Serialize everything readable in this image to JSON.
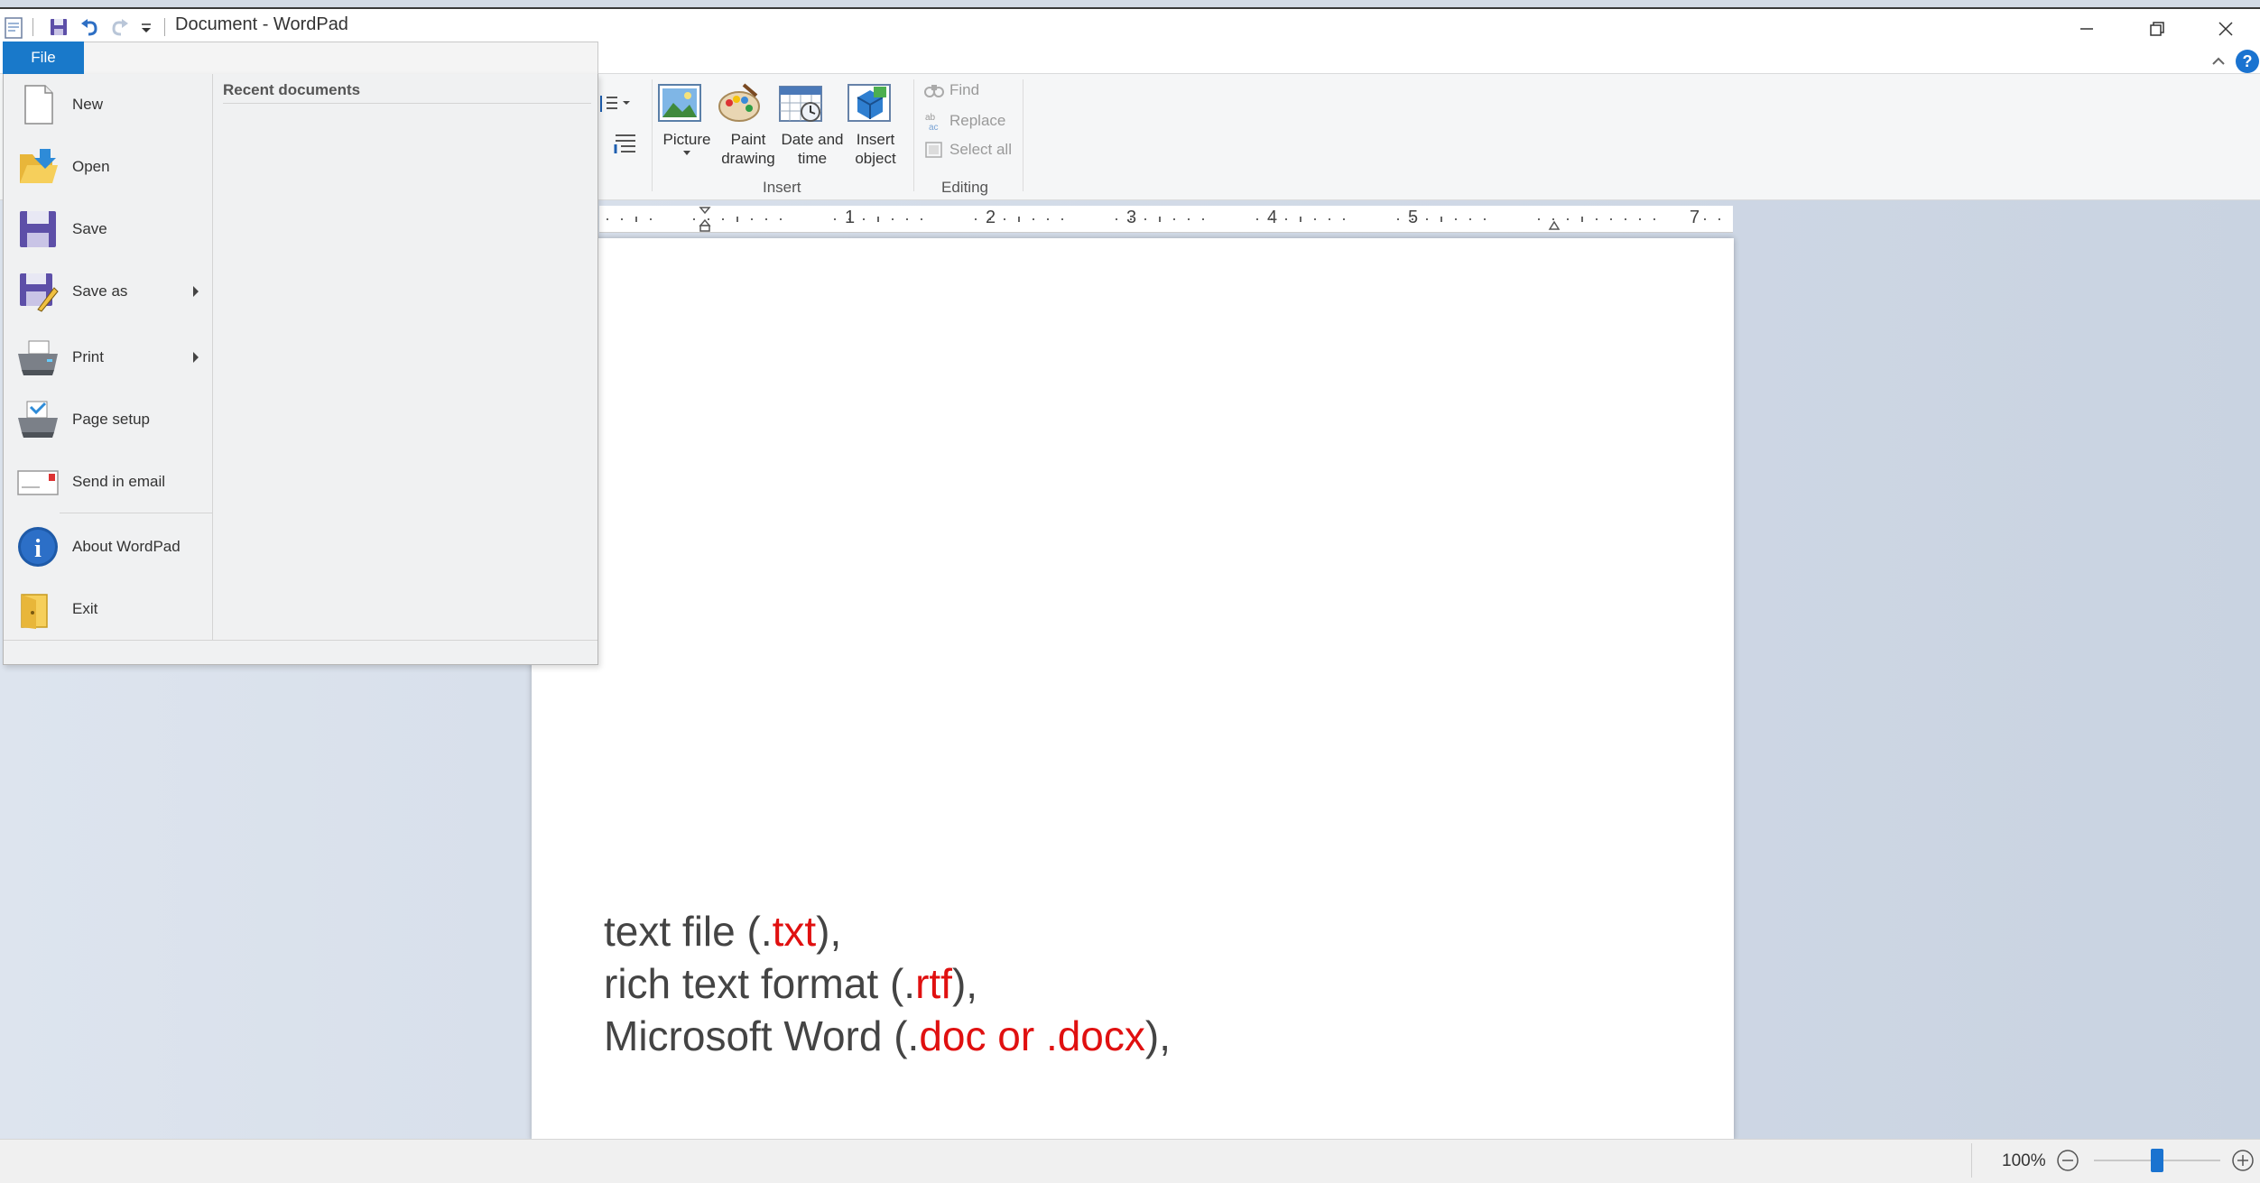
{
  "window": {
    "title": "Document - WordPad",
    "icons": {
      "app": "wordpad-icon",
      "save": "save-icon",
      "undo": "undo-icon",
      "redo": "redo-icon",
      "customize": "dropdown-icon",
      "minimize": "minimize-icon",
      "restore": "restore-icon",
      "close": "close-icon",
      "help": "help-icon",
      "collapse": "chevron-up-icon"
    }
  },
  "ribbon": {
    "insert_group": {
      "label": "Insert",
      "buttons": [
        {
          "line1": "Picture",
          "line2": "",
          "icon": "picture-icon"
        },
        {
          "line1": "Paint",
          "line2": "drawing",
          "icon": "paint-icon"
        },
        {
          "line1": "Date and",
          "line2": "time",
          "icon": "calendar-icon"
        },
        {
          "line1": "Insert",
          "line2": "object",
          "icon": "object-icon"
        }
      ]
    },
    "editing_group": {
      "label": "Editing",
      "find": "Find",
      "replace": "Replace",
      "select_all": "Select all"
    }
  },
  "ruler": {
    "numbers": [
      "1",
      "2",
      "3",
      "4",
      "5",
      "7"
    ]
  },
  "file_menu": {
    "tab_label": "File",
    "items": [
      {
        "label": "New",
        "icon": "new-document-icon",
        "submenu": false
      },
      {
        "label": "Open",
        "icon": "open-folder-icon",
        "submenu": false
      },
      {
        "label": "Save",
        "icon": "floppy-save-icon",
        "submenu": false
      },
      {
        "label": "Save as",
        "icon": "save-as-icon",
        "submenu": true
      },
      {
        "label": "Print",
        "icon": "printer-icon",
        "submenu": true
      },
      {
        "label": "Page setup",
        "icon": "page-setup-icon",
        "submenu": false
      },
      {
        "label": "Send in email",
        "icon": "email-icon",
        "submenu": false
      },
      {
        "label": "About WordPad",
        "icon": "info-icon",
        "submenu": false
      },
      {
        "label": "Exit",
        "icon": "exit-icon",
        "submenu": false
      }
    ],
    "recent_title": "Recent documents"
  },
  "document": {
    "lines": [
      {
        "pre": "text file (.",
        "hl": "txt",
        "post": "),"
      },
      {
        "pre": "rich text format (.",
        "hl": "rtf",
        "post": "),"
      },
      {
        "pre": "Microsoft Word (.",
        "hl": "doc or .docx",
        "post": "),"
      }
    ],
    "highlight_color": "#e01010"
  },
  "status": {
    "zoom": "100%",
    "zoom_level": 0.5
  }
}
